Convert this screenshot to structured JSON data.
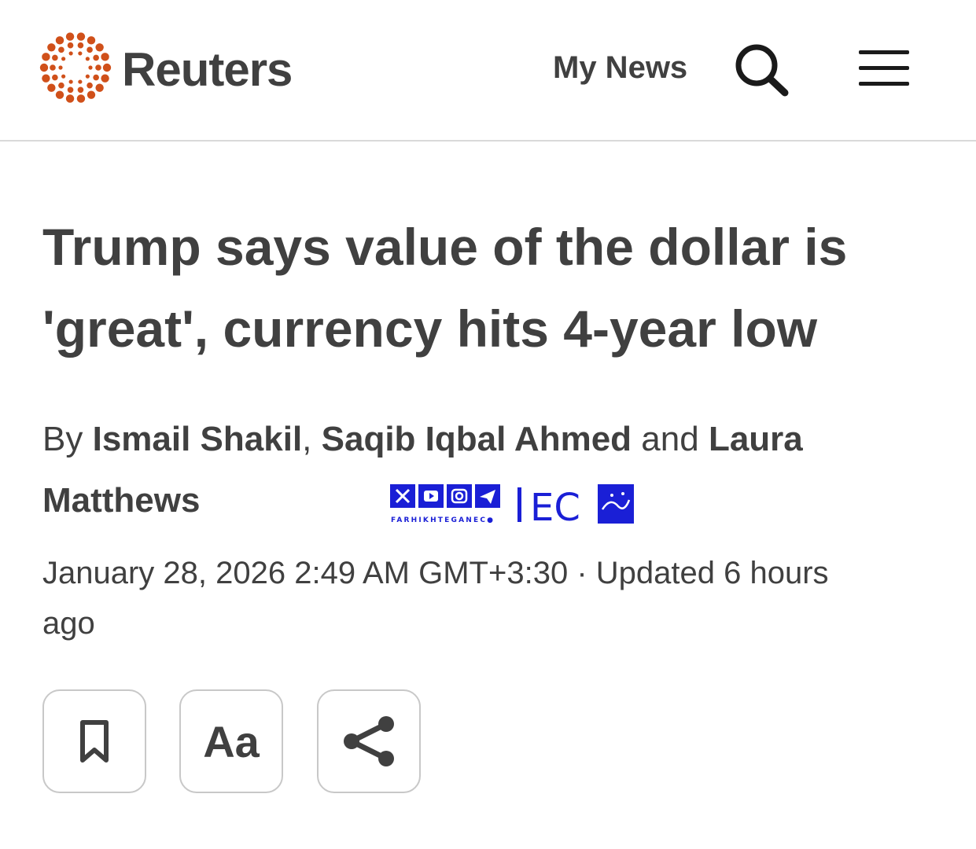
{
  "header": {
    "brand": "Reuters",
    "my_news_label": "My News",
    "logo_color": "#d0501a"
  },
  "article": {
    "headline_line1": "Trump says value of the dollar is",
    "headline_line2": "'great', currency hits 4-year low",
    "byline": {
      "prefix": "By",
      "author1": "Ismail Shakil",
      "comma": ",",
      "author2": "Saqib Iqbal Ahmed",
      "and": "and",
      "author3_first": "Laura",
      "author3_last": "Matthews"
    },
    "date": "January 28, 2026 2:49 AM GMT+3:30",
    "separator": "·",
    "updated": "Updated 6 hours",
    "updated_end": "ago"
  },
  "watermark": {
    "caption": "FARHIKHTEGANEC●",
    "mark": "EC",
    "color": "#1a1fd6"
  },
  "actions": {
    "bookmark_icon": "bookmark-icon",
    "text_size_label": "Aa",
    "share_icon": "share-icon"
  }
}
